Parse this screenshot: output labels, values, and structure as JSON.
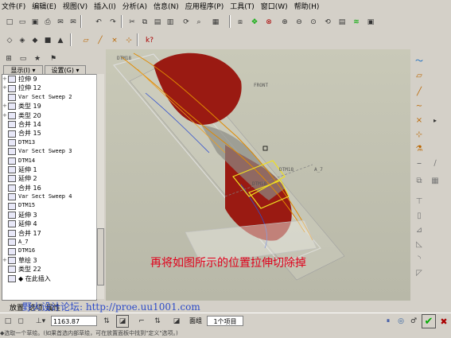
{
  "menu": [
    "文件(F)",
    "编辑(E)",
    "视图(V)",
    "插入(I)",
    "分析(A)",
    "信息(N)",
    "应用程序(P)",
    "工具(T)",
    "窗口(W)",
    "帮助(H)"
  ],
  "left_panel": {
    "display_label": "显示(I) ▾",
    "settings_label": "设置(G) ▾"
  },
  "tree": [
    {
      "pm": "+",
      "label": "拉伸 9",
      "mono": false
    },
    {
      "pm": "+",
      "label": "拉伸 12",
      "mono": false
    },
    {
      "pm": "",
      "label": "Var Sect Sweep 2",
      "mono": true
    },
    {
      "pm": "+",
      "label": "类型 19",
      "mono": false
    },
    {
      "pm": "+",
      "label": "类型 20",
      "mono": false
    },
    {
      "pm": "",
      "label": "合并 14",
      "mono": false
    },
    {
      "pm": "",
      "label": "合并 15",
      "mono": false
    },
    {
      "pm": "",
      "label": "DTM13",
      "mono": true
    },
    {
      "pm": "",
      "label": "Var Sect Sweep 3",
      "mono": true
    },
    {
      "pm": "",
      "label": "DTM14",
      "mono": true
    },
    {
      "pm": "",
      "label": "延伸 1",
      "mono": false
    },
    {
      "pm": "",
      "label": "延伸 2",
      "mono": false
    },
    {
      "pm": "",
      "label": "合并 16",
      "mono": false
    },
    {
      "pm": "",
      "label": "Var Sect Sweep 4",
      "mono": true
    },
    {
      "pm": "",
      "label": "DTM15",
      "mono": true
    },
    {
      "pm": "",
      "label": "延伸 3",
      "mono": false
    },
    {
      "pm": "",
      "label": "延伸 4",
      "mono": false
    },
    {
      "pm": "",
      "label": "合并 17",
      "mono": false
    },
    {
      "pm": "",
      "label": "A_7",
      "mono": true
    },
    {
      "pm": "",
      "label": "DTM16",
      "mono": true
    },
    {
      "pm": "+",
      "label": "草绘 3",
      "mono": false
    },
    {
      "pm": "",
      "label": "类型 22",
      "mono": false
    },
    {
      "pm": "",
      "label": "◆ 在此插入",
      "mono": false
    }
  ],
  "viewport": {
    "caption": "再将如图所示的位置拉伸切除掉",
    "caption_color": "#e0001b",
    "label_front": "FRONT",
    "label_dtm": "DTM18",
    "label_a7": "A_7",
    "label_dtm_top": "DTM18",
    "label_cut": "DTM18"
  },
  "bottom": {
    "tabs": [
      "放置",
      "选项",
      "属性"
    ],
    "watermark": "野火设计论坛: http://proe.uu1001.com",
    "depth_value": "1163.87",
    "surface_label": "面组",
    "items_value": "1个项目",
    "status_text": "◆选取一个草绘。(如果首选内部草绘，可在放置面板中找到\"定义\"选项。)"
  },
  "colors": {
    "part_red": "#9a1a12",
    "highlight_yellow": "#f0e020",
    "watermark_blue": "#1a3cc8"
  }
}
